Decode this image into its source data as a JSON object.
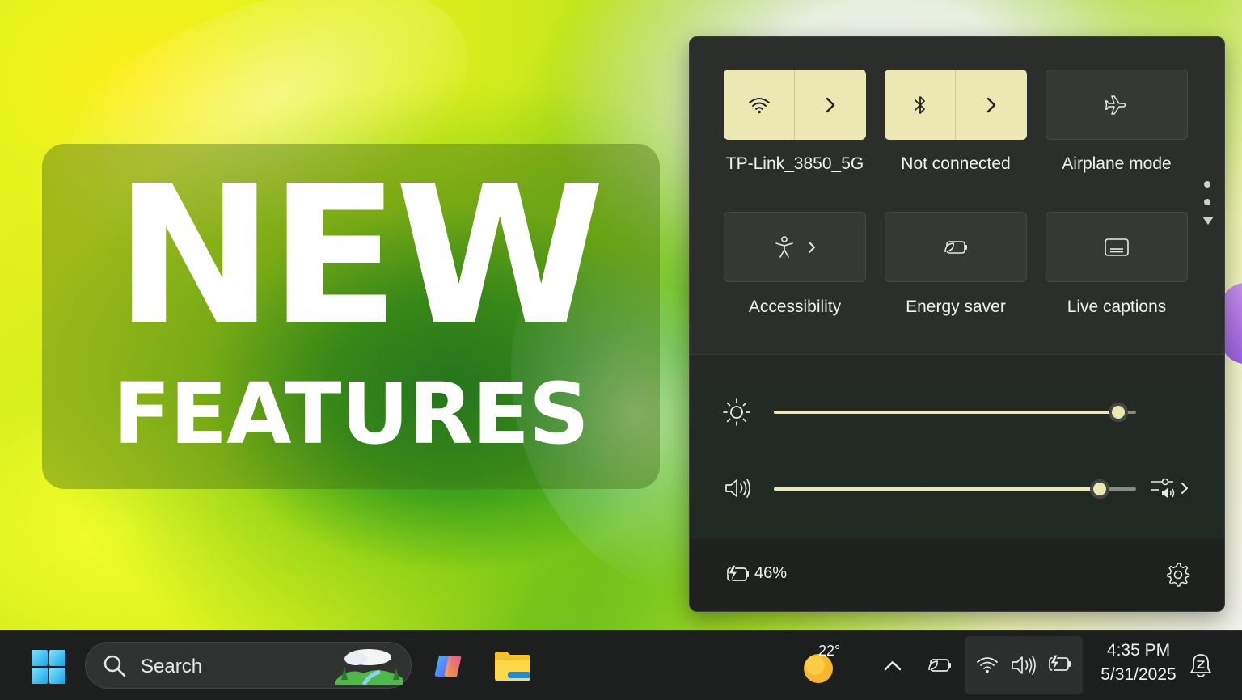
{
  "wallpaper": {
    "headline": "NEW",
    "subheadline": "FEATURES"
  },
  "quick_settings": {
    "tiles": [
      {
        "label": "TP-Link_3850_5G",
        "icon": "wifi-icon",
        "state": "on",
        "expandable": true
      },
      {
        "label": "Not connected",
        "icon": "bluetooth-icon",
        "state": "on",
        "expandable": true
      },
      {
        "label": "Airplane mode",
        "icon": "airplane-icon",
        "state": "off",
        "expandable": false
      },
      {
        "label": "Accessibility",
        "icon": "accessibility-icon",
        "state": "off",
        "expandable": true
      },
      {
        "label": "Energy saver",
        "icon": "energy-saver-icon",
        "state": "off",
        "expandable": false
      },
      {
        "label": "Live captions",
        "icon": "captions-icon",
        "state": "off",
        "expandable": false
      }
    ],
    "pager": {
      "pages": 2,
      "current": 1
    },
    "brightness": {
      "icon": "brightness-icon",
      "level": 0.95
    },
    "volume": {
      "icon": "volume-icon",
      "level": 0.9,
      "mixer_icon": "audio-mixer-icon"
    },
    "battery": {
      "icon": "battery-charging-icon",
      "percent_text": "46%"
    },
    "settings_icon": "gear-icon"
  },
  "taskbar": {
    "start_icon": "windows-start-icon",
    "search": {
      "placeholder": "Search",
      "icon": "search-icon",
      "highlight_icon": "landscape-icon"
    },
    "apps": [
      {
        "name": "Copilot",
        "icon": "copilot-icon"
      },
      {
        "name": "File Explorer",
        "icon": "folder-icon"
      }
    ],
    "weather": {
      "temperature": "22°",
      "icon": "weather-sun-icon"
    },
    "tray": {
      "overflow_icon": "chevron-up-icon",
      "energy_icon": "energy-saver-icon",
      "group_icons": [
        "wifi-icon",
        "volume-icon",
        "battery-charging-icon"
      ]
    },
    "clock": {
      "time": "4:35 PM",
      "date": "5/31/2025"
    },
    "notification_icon": "notification-bell-icon"
  },
  "colors": {
    "accent": "#ece8b4",
    "panel": "#2c2e2c",
    "taskbar": "#1c1f1d"
  }
}
